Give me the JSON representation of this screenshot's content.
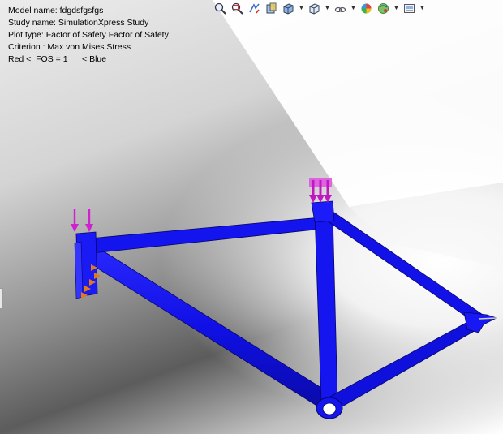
{
  "info": {
    "model_name": "Model name: fdgdsfgsfgs",
    "study_name": "Study name: SimulationXpress Study",
    "plot_type": "Plot type: Factor of Safety Factor of Safety",
    "criterion": "Criterion : Max von Mises Stress",
    "legend_text": "Red <  FOS = 1      < Blue"
  },
  "toolbar": {
    "icons": [
      "zoom-to-fit-icon",
      "zoom-to-area-icon",
      "previous-view-icon",
      "section-view-icon",
      "view-orientation-icon",
      "display-style-icon",
      "hide-show-items-icon",
      "edit-appearance-icon",
      "apply-scene-icon",
      "view-settings-icon"
    ]
  },
  "colors": {
    "frame": "#1010e6",
    "frame_dark": "#0a0aa0",
    "load_arrow": "#d020d0",
    "fixture": "#e07a18"
  }
}
